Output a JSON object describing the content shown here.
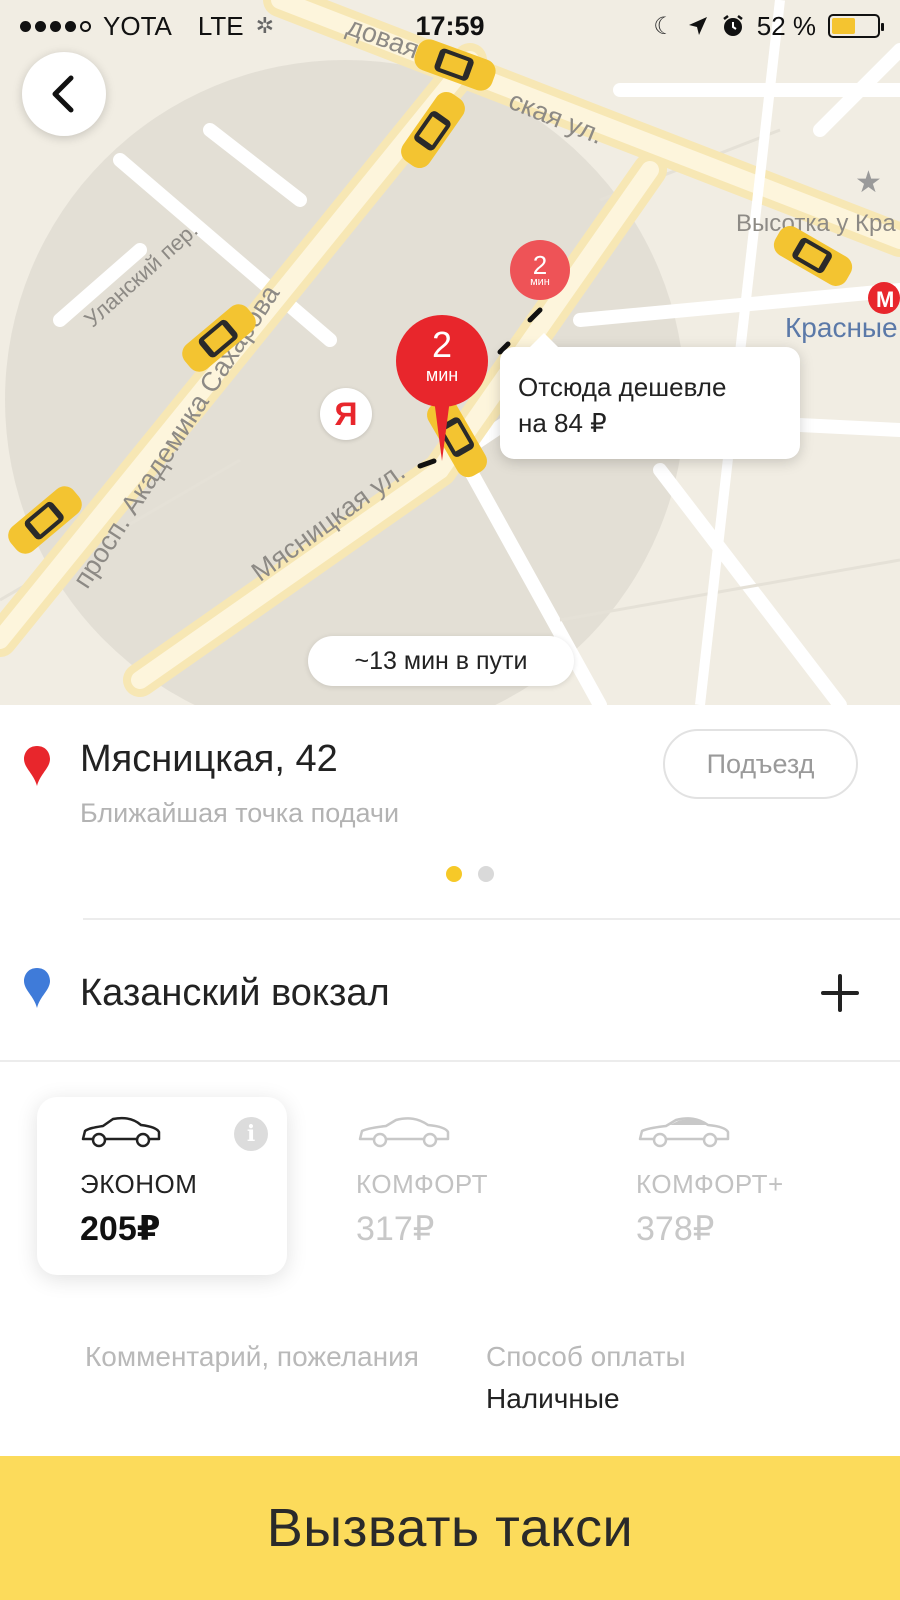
{
  "status_bar": {
    "carrier": "YOTA",
    "network": "LTE",
    "time": "17:59",
    "battery_text": "52 %",
    "battery_level": 0.52
  },
  "map": {
    "streets": {
      "upper_street": "ская ул.",
      "upper_street_prefix": "довая",
      "sakharova": "просп. Академика Сахарова",
      "myasnitskaya": "Мясницкая ул.",
      "ulansky": "Уланский пер.",
      "vysotka": "Высотка у Кра",
      "metro": "Красные"
    },
    "eta_pin_big": {
      "value": "2",
      "unit": "мин"
    },
    "eta_pin_small": {
      "value": "2",
      "unit": "мин"
    },
    "callout": {
      "line1": "Отсюда дешевле",
      "line2": "на 84 ₽"
    },
    "logo_letter": "Я",
    "trip_time": "~13 мин в пути"
  },
  "pickup": {
    "address": "Мясницкая, 42",
    "subtitle": "Ближайшая точка подачи",
    "entrance_button": "Подъезд"
  },
  "destination": {
    "address": "Казанский вокзал"
  },
  "tariffs": [
    {
      "name": "ЭКОНОМ",
      "price": "205₽",
      "selected": true
    },
    {
      "name": "КОМФОРТ",
      "price": "317₽",
      "selected": false
    },
    {
      "name": "КОМФОРТ+",
      "price": "378₽",
      "selected": false
    }
  ],
  "options": {
    "comment": "Комментарий, пожелания",
    "payment_label": "Способ оплаты",
    "payment_value": "Наличные"
  },
  "call_button": "Вызвать такси",
  "colors": {
    "accent_yellow": "#fcdb5b",
    "pin_red": "#e8262c",
    "destination_blue": "#3f7bd9"
  }
}
